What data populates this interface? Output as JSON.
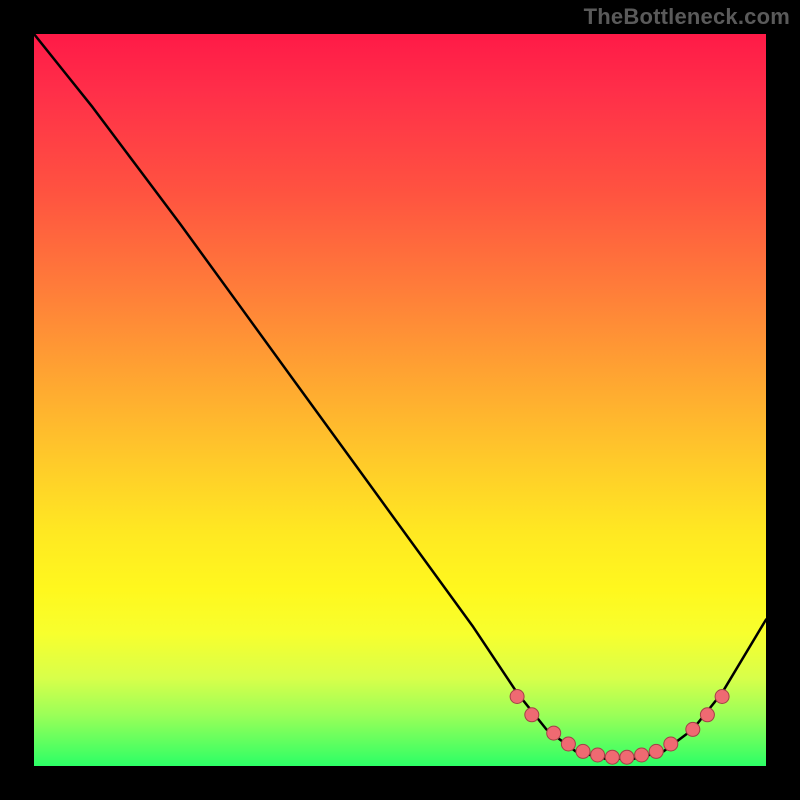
{
  "watermark": "TheBottleneck.com",
  "colors": {
    "curve_stroke": "#000000",
    "dot_fill": "#ef6a72",
    "dot_stroke": "#a34147",
    "bg": "#000000"
  },
  "chart_data": {
    "type": "line",
    "title": "",
    "xlabel": "",
    "ylabel": "",
    "xlim": [
      0,
      100
    ],
    "ylim": [
      0,
      100
    ],
    "series": [
      {
        "name": "curve",
        "x": [
          0,
          4,
          8,
          14,
          20,
          28,
          36,
          44,
          52,
          60,
          66,
          70,
          74,
          78,
          82,
          86,
          90,
          94,
          100
        ],
        "y": [
          100,
          95,
          90,
          82,
          74,
          63,
          52,
          41,
          30,
          19,
          10,
          5,
          2,
          1,
          1,
          2,
          5,
          10,
          20
        ]
      }
    ],
    "dots": {
      "name": "highlight-dots",
      "x": [
        66,
        68,
        71,
        73,
        75,
        77,
        79,
        81,
        83,
        85,
        87,
        90,
        92,
        94
      ],
      "y": [
        9.5,
        7,
        4.5,
        3,
        2,
        1.5,
        1.2,
        1.2,
        1.5,
        2,
        3,
        5,
        7,
        9.5
      ]
    }
  }
}
